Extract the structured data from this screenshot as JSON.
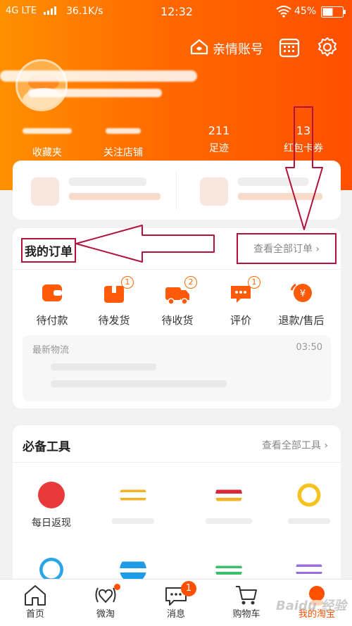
{
  "status_bar": {
    "network": "4G LTE",
    "speed": "36.1K/s",
    "time": "12:32",
    "battery": "45%"
  },
  "header": {
    "family_account": "亲情账号"
  },
  "stats": [
    {
      "label": "收藏夹"
    },
    {
      "label": "关注店铺"
    },
    {
      "value": "211",
      "label": "足迹"
    },
    {
      "value": "13",
      "label": "红包卡券"
    }
  ],
  "orders": {
    "title": "我的订单",
    "view_all": "查看全部订单 ›",
    "items": [
      {
        "label": "待付款",
        "icon": "wallet-icon"
      },
      {
        "label": "待发货",
        "icon": "package-icon",
        "badge": "1"
      },
      {
        "label": "待收货",
        "icon": "truck-icon",
        "badge": "2"
      },
      {
        "label": "评价",
        "icon": "comment-icon",
        "badge": "1"
      },
      {
        "label": "退款/售后",
        "icon": "refund-icon"
      }
    ],
    "logistics_title": "最新物流",
    "logistics_time": "03:50"
  },
  "tools": {
    "title": "必备工具",
    "view_all": "查看全部工具 ›",
    "items": [
      {
        "label": "每日返现"
      }
    ]
  },
  "tabbar": {
    "items": [
      {
        "label": "首页"
      },
      {
        "label": "微淘"
      },
      {
        "label": "消息",
        "badge": "1"
      },
      {
        "label": "购物车"
      },
      {
        "label": "我的淘宝"
      }
    ]
  },
  "watermark": "Baidu 经验",
  "colors": {
    "brand": "#ff5000",
    "gradient_start": "#ff9000",
    "annotation": "#b3123a"
  }
}
